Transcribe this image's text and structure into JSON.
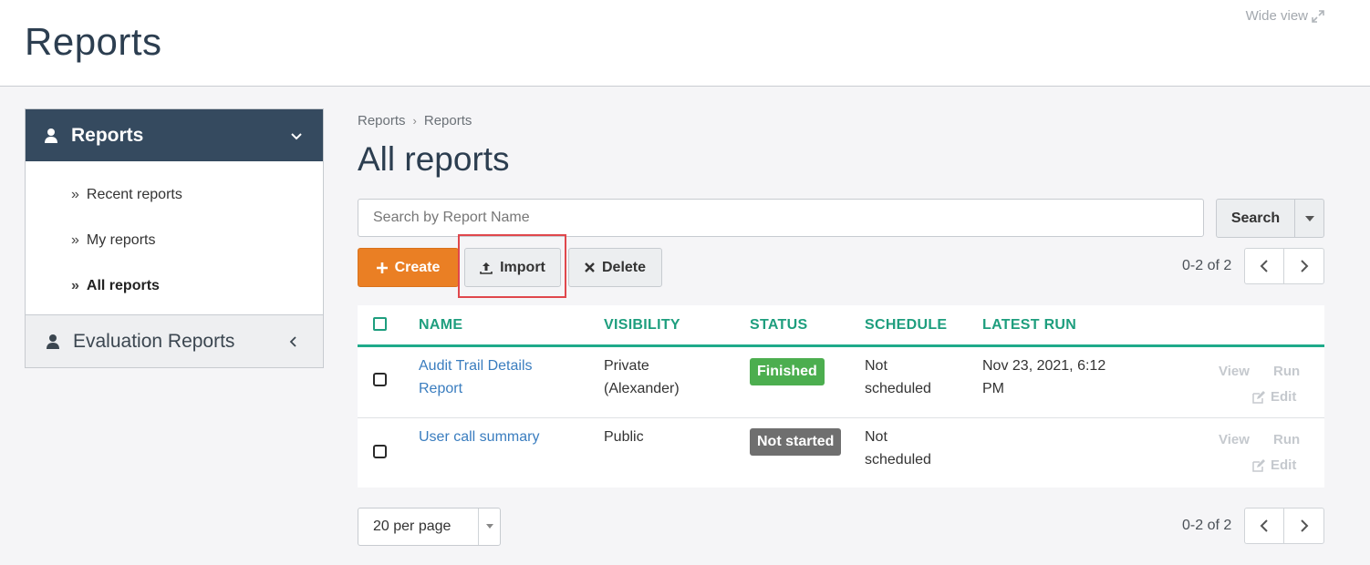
{
  "header": {
    "app_title": "Reports",
    "wide_view": "Wide view"
  },
  "sidebar": {
    "section": "Reports",
    "items": [
      {
        "label": "Recent reports",
        "active": false
      },
      {
        "label": "My reports",
        "active": false
      },
      {
        "label": "All reports",
        "active": true
      }
    ],
    "section2": "Evaluation Reports"
  },
  "breadcrumb": [
    "Reports",
    "Reports"
  ],
  "page_title": "All reports",
  "search": {
    "placeholder": "Search by Report Name",
    "value": "",
    "button": "Search"
  },
  "toolbar": {
    "create": "Create",
    "import": "Import",
    "delete": "Delete"
  },
  "pager": {
    "top_text": "0-2 of 2",
    "bottom_text": "0-2 of 2"
  },
  "table": {
    "columns": [
      "NAME",
      "VISIBILITY",
      "STATUS",
      "SCHEDULE",
      "LATEST RUN"
    ],
    "rows": [
      {
        "name_line1": "Audit Trail Details",
        "name_line2": "Report",
        "visibility_line1": "Private",
        "visibility_line2": "(Alexander)",
        "status": "Finished",
        "schedule_line1": "Not",
        "schedule_line2": "scheduled",
        "latest_run_line1": "Nov 23, 2021, 6:12",
        "latest_run_line2": "PM",
        "actions": {
          "view": "View",
          "run": "Run",
          "edit": "Edit"
        }
      },
      {
        "name_line1": "User call summary",
        "name_line2": "",
        "visibility_line1": "Public",
        "visibility_line2": "",
        "status": "Not started",
        "schedule_line1": "Not",
        "schedule_line2": "scheduled",
        "latest_run_line1": "",
        "latest_run_line2": "",
        "actions": {
          "view": "View",
          "run": "Run",
          "edit": "Edit"
        }
      }
    ]
  },
  "per_page": "20 per page",
  "colors": {
    "sidebar_header": "#354a5f",
    "accent_orange": "#ea7f24",
    "table_header": "#1e9e7e",
    "link": "#3a7dbf",
    "status_finished": "#4cae4f",
    "status_not_started": "#6f6f6f",
    "highlight": "#e0474c"
  },
  "icons": [
    "expand-icon",
    "user-icon",
    "chevron-down-icon",
    "chevron-left-icon",
    "plus-icon",
    "upload-icon",
    "close-icon",
    "caret-down-icon",
    "edit-icon"
  ]
}
